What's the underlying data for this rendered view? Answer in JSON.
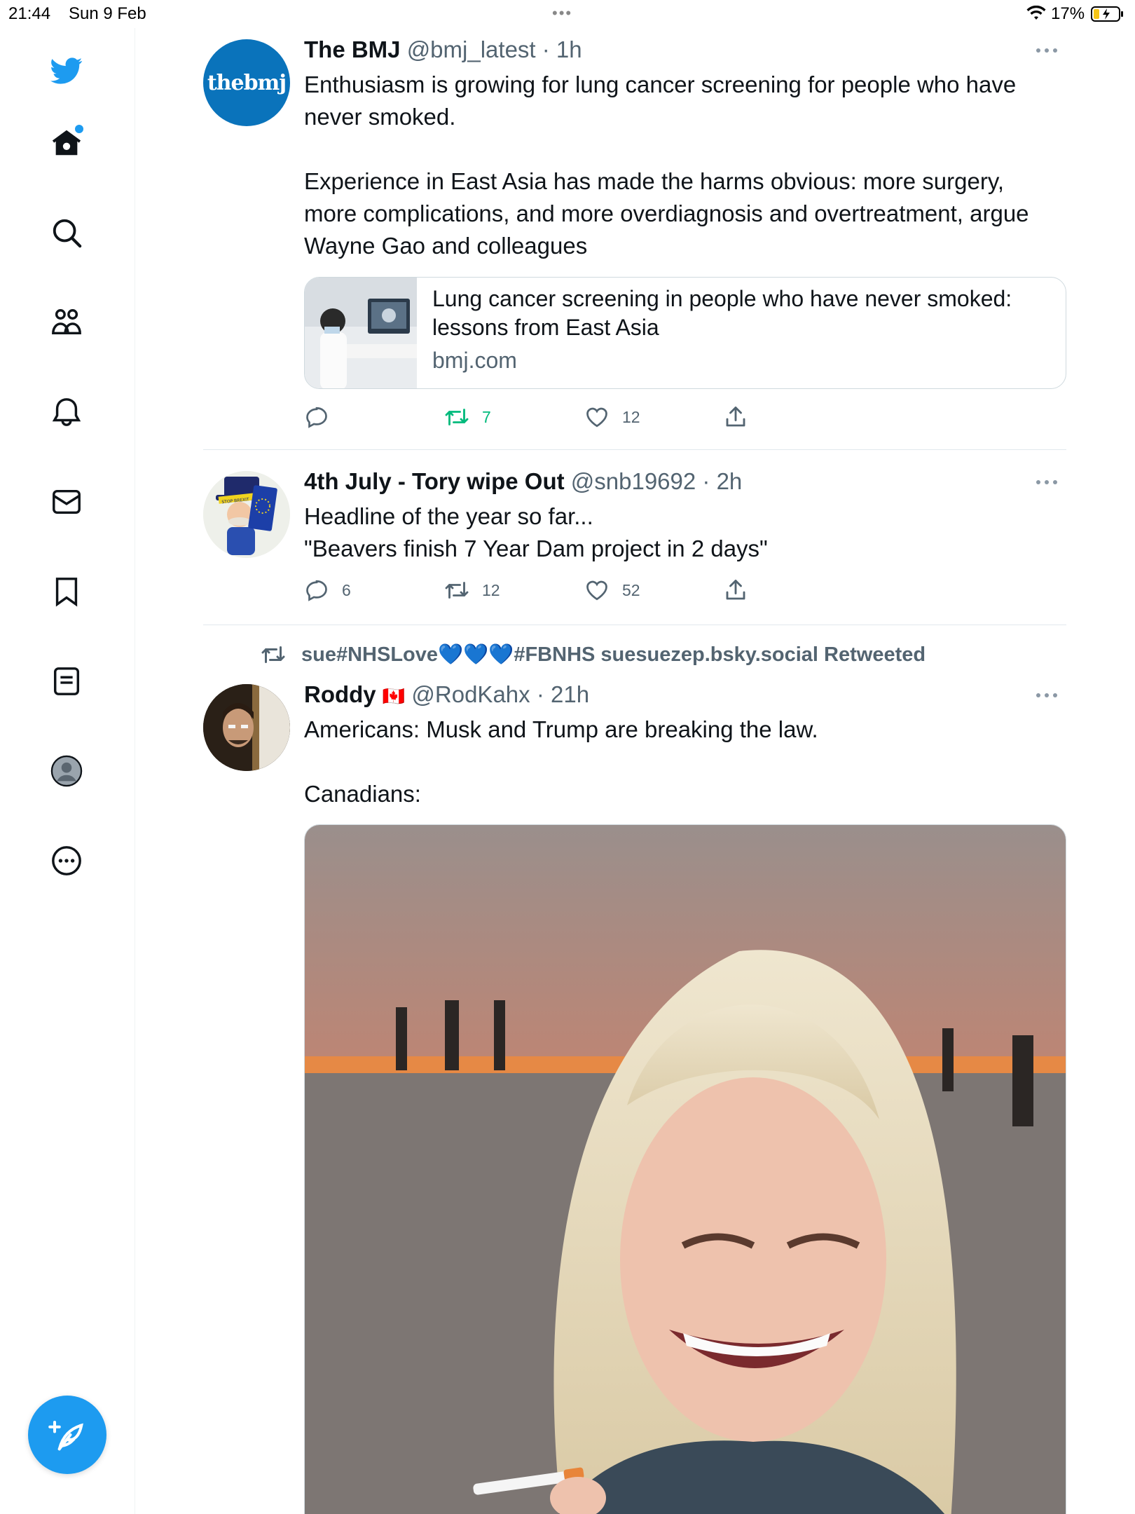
{
  "status_bar": {
    "time": "21:44",
    "date": "Sun 9 Feb",
    "battery": "17%"
  },
  "sidebar": {
    "items": [
      {
        "name": "twitter-logo-icon"
      },
      {
        "name": "home-icon"
      },
      {
        "name": "search-icon"
      },
      {
        "name": "communities-icon"
      },
      {
        "name": "notifications-icon"
      },
      {
        "name": "messages-icon"
      },
      {
        "name": "bookmarks-icon"
      },
      {
        "name": "lists-icon"
      },
      {
        "name": "profile-icon"
      },
      {
        "name": "more-icon"
      }
    ],
    "compose_icon": "compose-feather-icon",
    "accent": "#1d9bf0"
  },
  "tweets": [
    {
      "avatar_text": "thebmj",
      "name": "The BMJ",
      "handle": "@bmj_latest",
      "time": " · 1h",
      "text": "Enthusiasm is growing for lung cancer screening for people who have never smoked.\n\nExperience in East Asia has made the harms obvious: more surgery, more complications, and more overdiagnosis and overtreatment, argue Wayne Gao and colleagues",
      "card": {
        "title": "Lung cancer screening in people who have never smoked: lessons from East Asia",
        "domain": "bmj.com"
      },
      "replies": "",
      "retweets": "7",
      "likes": "12"
    },
    {
      "name": "4th July - Tory wipe Out",
      "handle": "@snb19692",
      "time": " · 2h",
      "text": "Headline of the year so far...\n\"Beavers finish 7 Year Dam project in 2 days\"",
      "avatar_sign": "STOP BREXIT",
      "replies": "6",
      "retweets": "12",
      "likes": "52"
    },
    {
      "retweeted_by_prefix": "sue#NHSLove",
      "retweeted_by_hearts": "💙💙💙",
      "retweeted_by_suffix": "#FBNHS suesuezep.bsky.social Retweeted",
      "name": "Roddy",
      "flag": "🇨🇦",
      "handle": "@RodKahx",
      "time": " · 21h",
      "text": "Americans: Musk and Trump are breaking the law.\n\nCanadians:"
    }
  ]
}
